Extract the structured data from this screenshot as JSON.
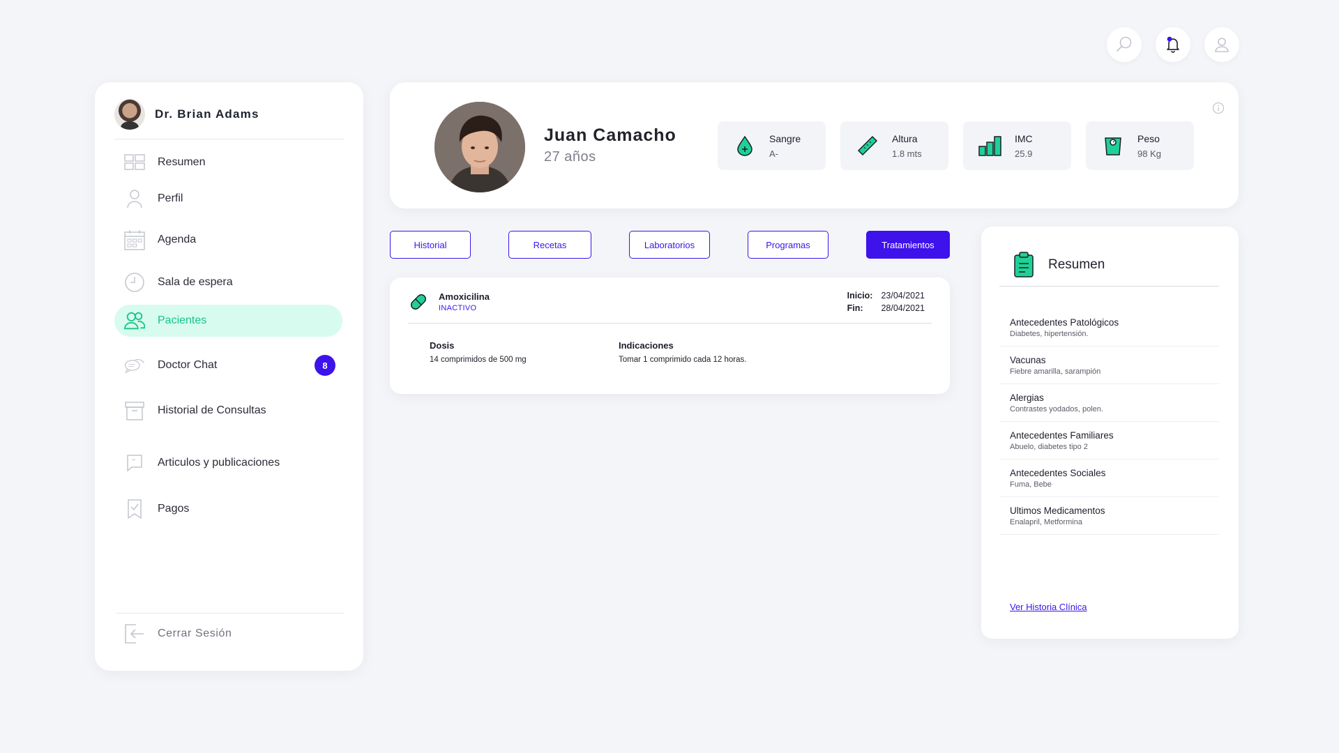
{
  "header": {
    "icons": [
      "search-icon",
      "bell-icon",
      "user-icon"
    ]
  },
  "sidebar": {
    "doctor_name": "Dr. Brian Adams",
    "items": [
      {
        "label": "Resumen",
        "icon": "grid-icon"
      },
      {
        "label": "Perfil",
        "icon": "person-icon"
      },
      {
        "label": "Agenda",
        "icon": "calendar-icon"
      },
      {
        "label": "Sala de espera",
        "icon": "clock-icon"
      },
      {
        "label": "Pacientes",
        "icon": "users-icon",
        "active": true
      },
      {
        "label": "Doctor Chat",
        "icon": "chat-icon",
        "badge": "8"
      },
      {
        "label": "Historial de Consultas",
        "icon": "archive-icon"
      },
      {
        "label": "Articulos y publicaciones",
        "icon": "quote-icon"
      },
      {
        "label": "Pagos",
        "icon": "receipt-icon"
      }
    ],
    "logout_label": "Cerrar Sesión"
  },
  "patient": {
    "name": "Juan Camacho",
    "age": "27 años",
    "stats": [
      {
        "label": "Sangre",
        "value": "A-",
        "icon": "drop-icon"
      },
      {
        "label": "Altura",
        "value": "1.8 mts",
        "icon": "ruler-icon"
      },
      {
        "label": "IMC",
        "value": "25.9",
        "icon": "bars-icon"
      },
      {
        "label": "Peso",
        "value": "98 Kg",
        "icon": "scale-icon"
      }
    ]
  },
  "tabs": [
    {
      "label": "Historial"
    },
    {
      "label": "Recetas"
    },
    {
      "label": "Laboratorios"
    },
    {
      "label": "Programas"
    },
    {
      "label": "Tratamientos",
      "active": true
    }
  ],
  "treatment": {
    "name": "Amoxicilina",
    "status": "INACTIVO",
    "start_label": "Inicio:",
    "start_date": "23/04/2021",
    "end_label": "Fin:",
    "end_date": "28/04/2021",
    "dose_title": "Dosis",
    "dose_value": "14 comprimidos de 500 mg",
    "ind_title": "Indicaciones",
    "ind_value": "Tomar 1 comprimido cada 12 horas."
  },
  "summary": {
    "title": "Resumen",
    "items": [
      {
        "title": "Antecedentes Patológicos",
        "detail": "Diabetes, hipertensión."
      },
      {
        "title": "Vacunas",
        "detail": "Fiebre amarilla, sarampión"
      },
      {
        "title": "Alergias",
        "detail": "Contrastes yodados, polen."
      },
      {
        "title": "Antecedentes Familiares",
        "detail": "Abuelo, diabetes tipo 2"
      },
      {
        "title": "Antecedentes Sociales",
        "detail": "Fuma, Bebe"
      },
      {
        "title": "Ultimos Medicamentos",
        "detail": "Enalapril, Metformina"
      }
    ],
    "link": "Ver Historia Clínica"
  },
  "colors": {
    "accent": "#3d12eb",
    "green": "#18c587",
    "active_bg": "#d7fbef",
    "background": "#f4f5f9"
  }
}
